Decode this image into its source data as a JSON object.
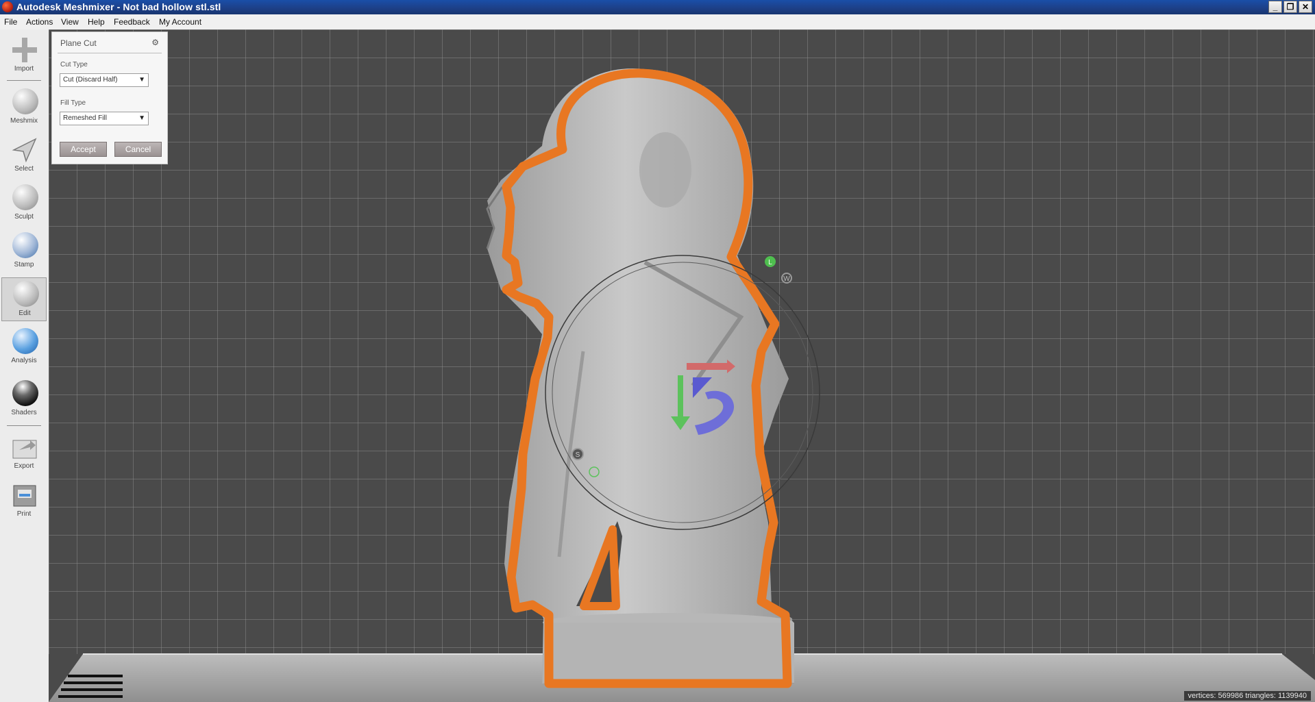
{
  "window": {
    "title": "Autodesk Meshmixer - Not bad hollow stl.stl"
  },
  "menu": [
    "File",
    "Actions",
    "View",
    "Help",
    "Feedback",
    "My Account"
  ],
  "tools": [
    "Import",
    "Meshmix",
    "Select",
    "Sculpt",
    "Stamp",
    "Edit",
    "Analysis",
    "Shaders",
    "Export",
    "Print"
  ],
  "active_tool": "Edit",
  "panel": {
    "title": "Plane Cut",
    "cut_type_label": "Cut Type",
    "cut_type_value": "Cut (Discard Half)",
    "fill_type_label": "Fill Type",
    "fill_type_value": "Remeshed Fill",
    "accept": "Accept",
    "cancel": "Cancel"
  },
  "gizmo": {
    "handle_w": "W",
    "handle_l": "L",
    "handle_s": "S"
  },
  "status": "vertices: 569986 triangles: 1139940",
  "colors": {
    "outline": "#e87722",
    "background": "#4a4a4a",
    "grid": "#8c8c8c",
    "titlebar": "#1d3f86"
  }
}
